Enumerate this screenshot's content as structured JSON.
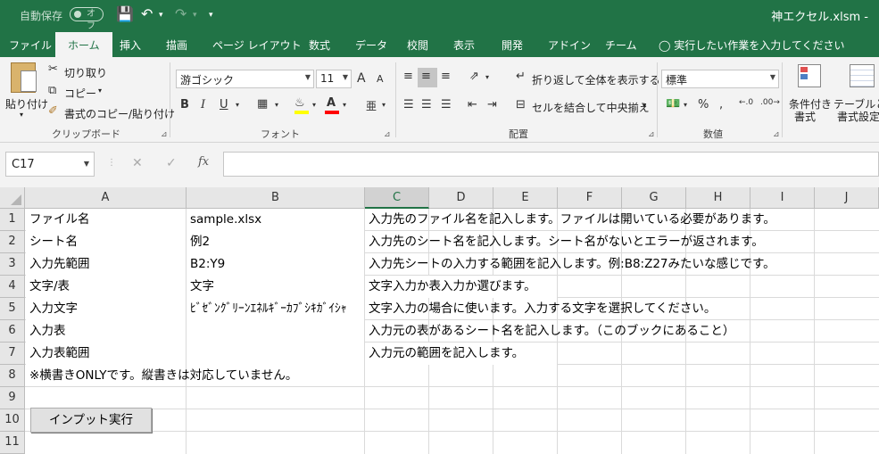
{
  "titlebar": {
    "autosave_label": "自動保存",
    "autosave_state": "オフ",
    "filename": "神エクセル.xlsm -"
  },
  "tabs": [
    "ファイル",
    "ホーム",
    "挿入",
    "描画",
    "ページ レイアウト",
    "数式",
    "データ",
    "校閲",
    "表示",
    "開発",
    "アドイン",
    "チーム"
  ],
  "active_tab": "ホーム",
  "tell_me": "実行したい作業を入力してください",
  "ribbon": {
    "clipboard": {
      "paste": "貼り付け",
      "cut": "切り取り",
      "copy": "コピー",
      "format_painter": "書式のコピー/貼り付け",
      "label": "クリップボード"
    },
    "font": {
      "name": "游ゴシック",
      "size": "11",
      "grow": "A",
      "shrink": "A",
      "bold": "B",
      "italic": "I",
      "underline": "U",
      "font_color_letter": "A",
      "phonetic": "亜",
      "label": "フォント"
    },
    "alignment": {
      "wrap_text": "折り返して全体を表示する",
      "merge_center": "セルを結合して中央揃え",
      "label": "配置"
    },
    "number": {
      "format": "標準",
      "percent": "%",
      "comma": ",",
      "label": "数値"
    },
    "styles": {
      "conditional": "条件付き",
      "conditional2": "書式",
      "table": "テーブルとし",
      "table2": "書式設定"
    }
  },
  "formula_bar": {
    "name_box": "C17",
    "cancel": "✕",
    "enter": "✓",
    "fx": "fx",
    "content": ""
  },
  "sheet": {
    "columns": [
      "A",
      "B",
      "C",
      "D",
      "E",
      "F",
      "G",
      "H",
      "I",
      "J"
    ],
    "selected_column": "C",
    "rows": [
      "1",
      "2",
      "3",
      "4",
      "5",
      "6",
      "7",
      "8",
      "9",
      "10",
      "11"
    ],
    "cells": {
      "A1": "ファイル名",
      "B1": "sample.xlsx",
      "C1": "入力先のファイル名を記入します。ファイルは開いている必要があります。",
      "A2": "シート名",
      "B2": "例2",
      "C2": "入力先のシート名を記入します。シート名がないとエラーが返されます。",
      "A3": "入力先範囲",
      "B3": "B2:Y9",
      "C3": "入力先シートの入力する範囲を記入します。例:B8:Z27みたいな感じです。",
      "A4": "文字/表",
      "B4": "文字",
      "C4": "文字入力か表入力か選びます。",
      "A5": "入力文字",
      "B5": "ﾋﾞｾﾞﾝｸﾞﾘｰﾝｴﾈﾙｷﾞｰｶﾌﾞｼｷｶﾞｲｼｬ",
      "C5": "文字入力の場合に使います。入力する文字を選択してください。",
      "A6": "入力表",
      "B6": "",
      "C6": "入力元の表があるシート名を記入します。（このブックにあること）",
      "A7": "入力表範囲",
      "B7": "",
      "C7": "入力元の範囲を記入します。",
      "A8": "※横書きONLYです。縦書きは対応していません。"
    },
    "run_button": "インプット実行"
  }
}
